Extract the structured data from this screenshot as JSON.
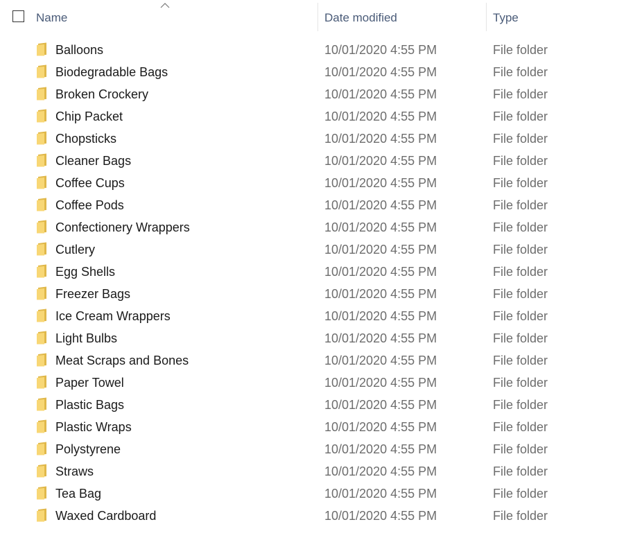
{
  "header": {
    "name_label": "Name",
    "date_label": "Date modified",
    "type_label": "Type",
    "sort": "ascending"
  },
  "colors": {
    "header_text": "#4a5b78",
    "name_text": "#1a1a1a",
    "secondary_text": "#6d6d6d",
    "folder_front": "#f8d775",
    "folder_back": "#e0b84a"
  },
  "icons": {
    "folder": "folder-icon",
    "sort": "chevron-up-icon",
    "checkbox": "checkbox-icon"
  },
  "files": [
    {
      "name": "Balloons",
      "date": "10/01/2020 4:55 PM",
      "type": "File folder"
    },
    {
      "name": "Biodegradable Bags",
      "date": "10/01/2020 4:55 PM",
      "type": "File folder"
    },
    {
      "name": "Broken Crockery",
      "date": "10/01/2020 4:55 PM",
      "type": "File folder"
    },
    {
      "name": "Chip Packet",
      "date": "10/01/2020 4:55 PM",
      "type": "File folder"
    },
    {
      "name": "Chopsticks",
      "date": "10/01/2020 4:55 PM",
      "type": "File folder"
    },
    {
      "name": "Cleaner Bags",
      "date": "10/01/2020 4:55 PM",
      "type": "File folder"
    },
    {
      "name": "Coffee Cups",
      "date": "10/01/2020 4:55 PM",
      "type": "File folder"
    },
    {
      "name": "Coffee Pods",
      "date": "10/01/2020 4:55 PM",
      "type": "File folder"
    },
    {
      "name": "Confectionery Wrappers",
      "date": "10/01/2020 4:55 PM",
      "type": "File folder"
    },
    {
      "name": "Cutlery",
      "date": "10/01/2020 4:55 PM",
      "type": "File folder"
    },
    {
      "name": "Egg Shells",
      "date": "10/01/2020 4:55 PM",
      "type": "File folder"
    },
    {
      "name": "Freezer Bags",
      "date": "10/01/2020 4:55 PM",
      "type": "File folder"
    },
    {
      "name": "Ice Cream Wrappers",
      "date": "10/01/2020 4:55 PM",
      "type": "File folder"
    },
    {
      "name": "Light Bulbs",
      "date": "10/01/2020 4:55 PM",
      "type": "File folder"
    },
    {
      "name": "Meat Scraps and Bones",
      "date": "10/01/2020 4:55 PM",
      "type": "File folder"
    },
    {
      "name": "Paper Towel",
      "date": "10/01/2020 4:55 PM",
      "type": "File folder"
    },
    {
      "name": "Plastic Bags",
      "date": "10/01/2020 4:55 PM",
      "type": "File folder"
    },
    {
      "name": "Plastic Wraps",
      "date": "10/01/2020 4:55 PM",
      "type": "File folder"
    },
    {
      "name": "Polystyrene",
      "date": "10/01/2020 4:55 PM",
      "type": "File folder"
    },
    {
      "name": "Straws",
      "date": "10/01/2020 4:55 PM",
      "type": "File folder"
    },
    {
      "name": "Tea Bag",
      "date": "10/01/2020 4:55 PM",
      "type": "File folder"
    },
    {
      "name": "Waxed Cardboard",
      "date": "10/01/2020 4:55 PM",
      "type": "File folder"
    }
  ]
}
